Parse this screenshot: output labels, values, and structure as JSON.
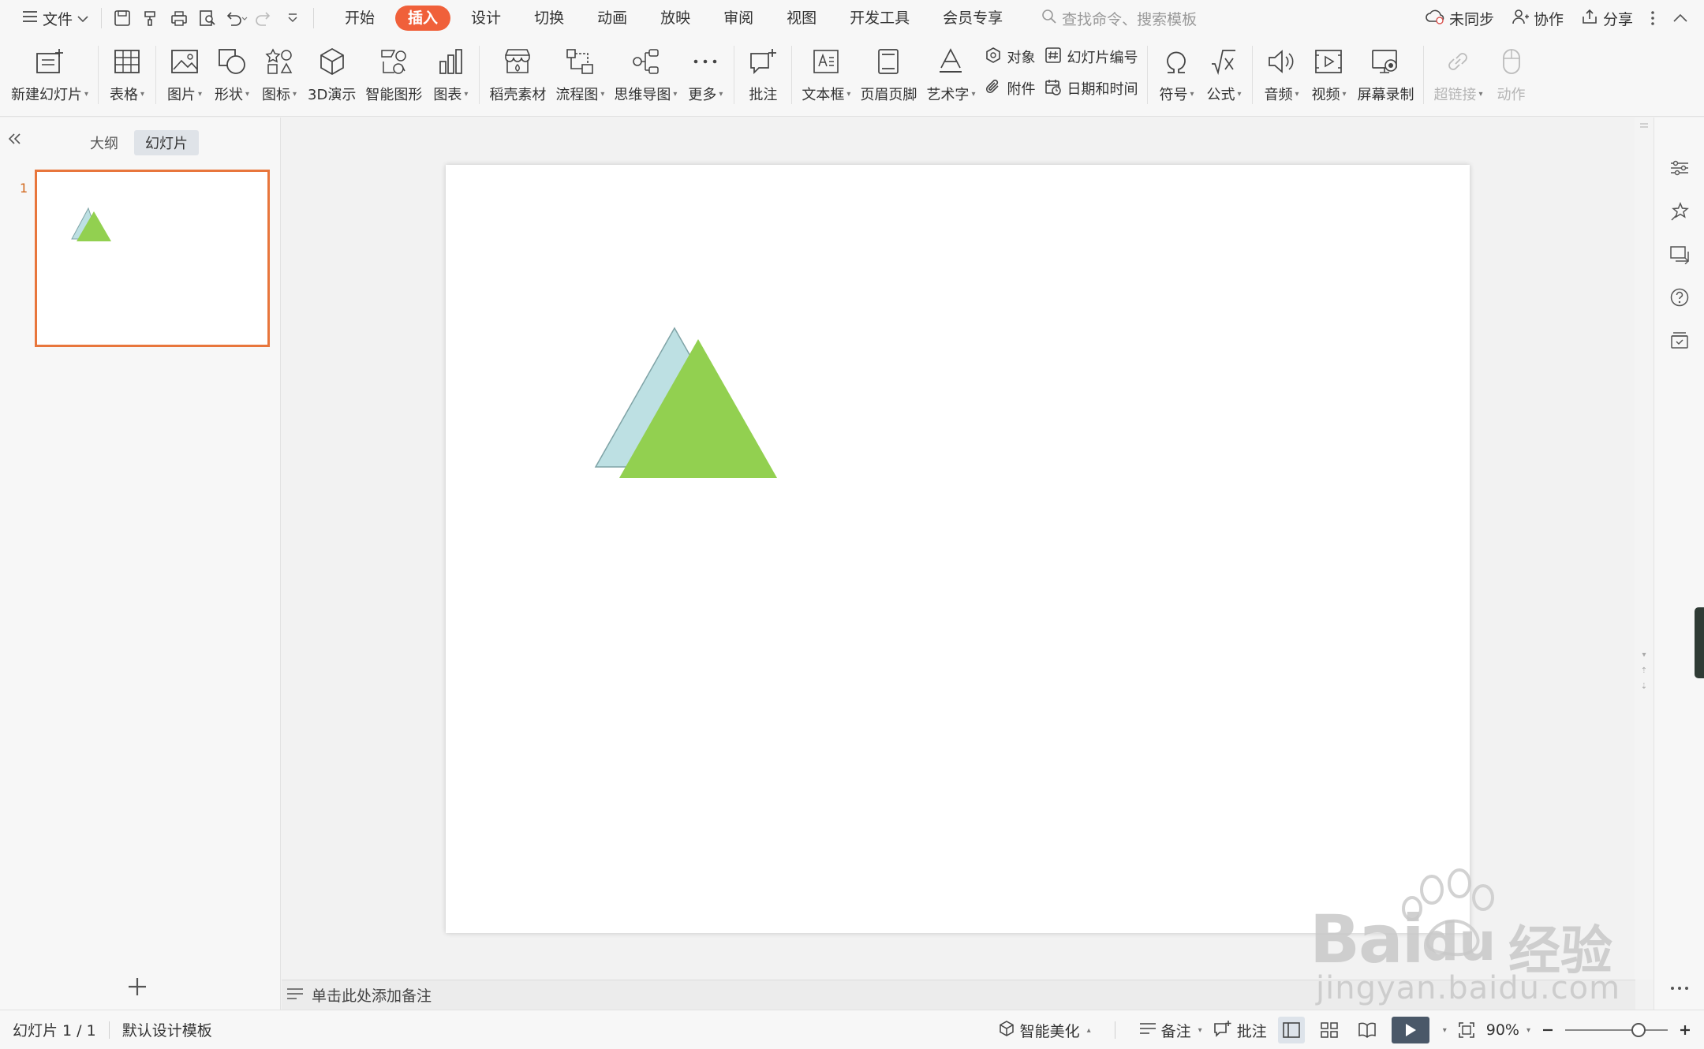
{
  "menubar": {
    "file_label": "文件",
    "tabs": [
      {
        "label": "开始",
        "active": false
      },
      {
        "label": "插入",
        "active": true
      },
      {
        "label": "设计",
        "active": false
      },
      {
        "label": "切换",
        "active": false
      },
      {
        "label": "动画",
        "active": false
      },
      {
        "label": "放映",
        "active": false
      },
      {
        "label": "审阅",
        "active": false
      },
      {
        "label": "视图",
        "active": false
      },
      {
        "label": "开发工具",
        "active": false
      },
      {
        "label": "会员专享",
        "active": false
      }
    ],
    "search_placeholder": "查找命令、搜索模板",
    "sync_label": "未同步",
    "collab_label": "协作",
    "share_label": "分享"
  },
  "ribbon": {
    "new_slide": "新建幻灯片",
    "table": "表格",
    "picture": "图片",
    "shape": "形状",
    "icon": "图标",
    "demo3d": "3D演示",
    "smart_graphic": "智能图形",
    "chart": "图表",
    "material": "稻壳素材",
    "flowchart": "流程图",
    "mindmap": "思维导图",
    "more": "更多",
    "comment": "批注",
    "textbox": "文本框",
    "header_footer": "页眉页脚",
    "wordart": "艺术字",
    "object": "对象",
    "attachment": "附件",
    "slide_number": "幻灯片编号",
    "datetime": "日期和时间",
    "symbol": "符号",
    "formula": "公式",
    "audio": "音频",
    "video": "视频",
    "screen_record": "屏幕录制",
    "hyperlink": "超链接",
    "action": "动作"
  },
  "leftpanel": {
    "tab_outline": "大纲",
    "tab_slides": "幻灯片",
    "slide_number": "1"
  },
  "slide": {
    "shapes": [
      {
        "type": "triangle",
        "fill": "#bde0e3",
        "stroke": "#7fa3a6"
      },
      {
        "type": "triangle",
        "fill": "#92d050",
        "stroke": "none"
      }
    ]
  },
  "notes_placeholder": "单击此处添加备注",
  "statusbar": {
    "slide_counter": "幻灯片 1 / 1",
    "template": "默认设计模板",
    "beautify": "智能美化",
    "notes": "备注",
    "comments": "批注",
    "zoom": "90%"
  },
  "watermark": {
    "brand": "Bai",
    "brand2": "du",
    "brand_cn": "经验",
    "url": "jingyan.baidu.com"
  },
  "colors": {
    "accent": "#f0603a",
    "thumb_border": "#e8763c",
    "play_button": "#4a5868"
  }
}
